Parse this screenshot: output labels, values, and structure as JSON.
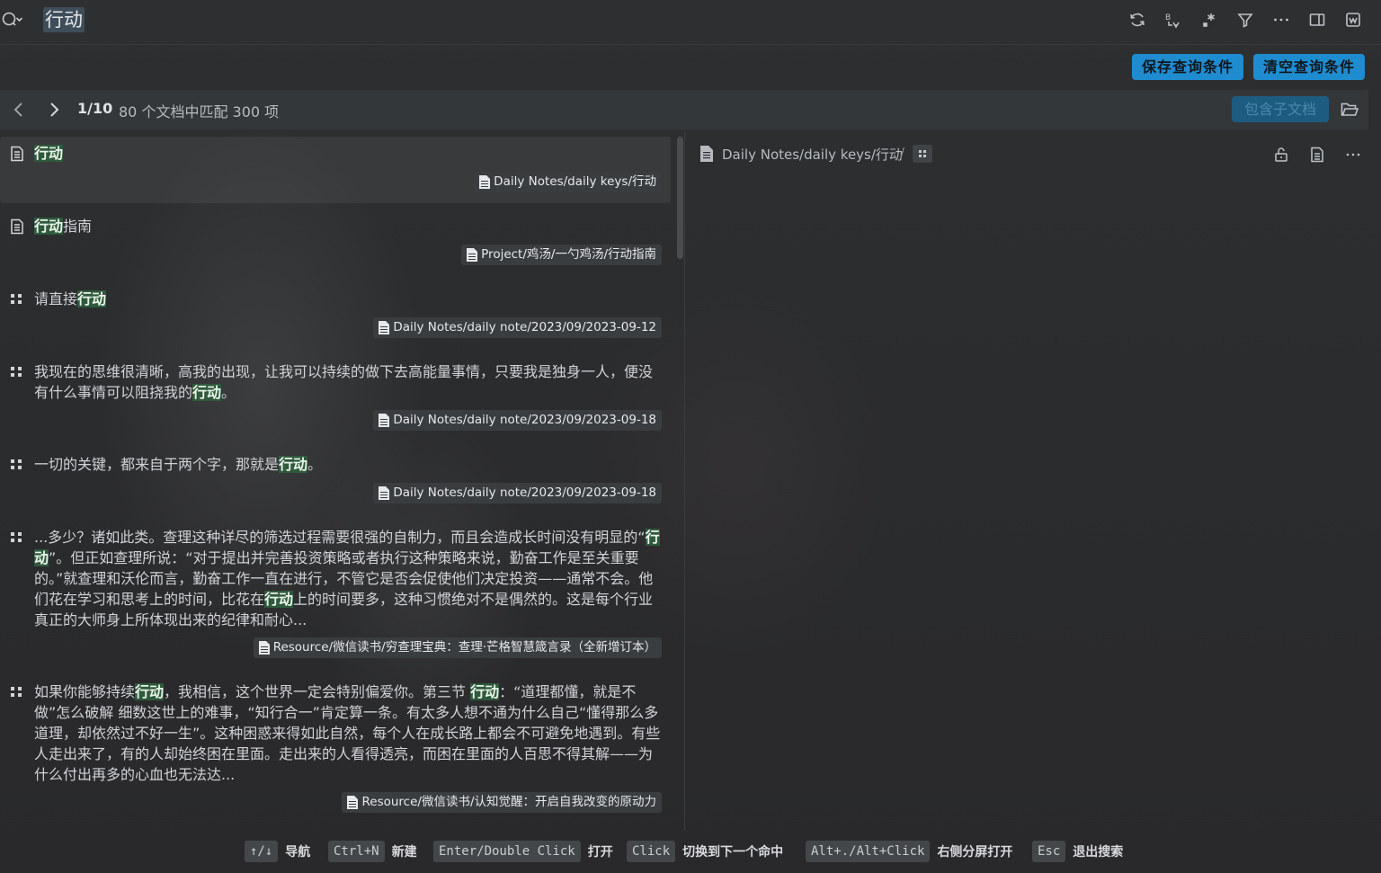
{
  "search": {
    "query": "行动"
  },
  "actions": {
    "save_query": "保存查询条件",
    "clear_query": "清空查询条件"
  },
  "nav": {
    "position": "1/10",
    "match_summary": "80 个文档中匹配 300 项",
    "include_children": "包含子文档"
  },
  "results": [
    {
      "type": "doc",
      "segments": [
        {
          "t": "行动",
          "hl": true
        }
      ],
      "path": "Daily Notes/daily keys/行动",
      "active": true
    },
    {
      "type": "doc",
      "segments": [
        {
          "t": "行动",
          "hl": true
        },
        {
          "t": "指南",
          "hl": false
        }
      ],
      "path": "Project/鸡汤/一勺鸡汤/行动指南"
    },
    {
      "type": "block",
      "segments": [
        {
          "t": "请直接",
          "hl": false
        },
        {
          "t": "行动",
          "hl": true
        }
      ],
      "path": "Daily Notes/daily note/2023/09/2023-09-12"
    },
    {
      "type": "block",
      "segments": [
        {
          "t": "我现在的思维很清晰，高我的出现，让我可以持续的做下去高能量事情，只要我是独身一人，便没有什么事情可以阻挠我的",
          "hl": false
        },
        {
          "t": "行动",
          "hl": true
        },
        {
          "t": "。",
          "hl": false
        }
      ],
      "path": "Daily Notes/daily note/2023/09/2023-09-18"
    },
    {
      "type": "block",
      "segments": [
        {
          "t": "一切的关键，都来自于两个字，那就是",
          "hl": false
        },
        {
          "t": "行动",
          "hl": true
        },
        {
          "t": "。",
          "hl": false
        }
      ],
      "path": "Daily Notes/daily note/2023/09/2023-09-18"
    },
    {
      "type": "block",
      "segments": [
        {
          "t": "...多少？诸如此类。查理这种详尽的筛选过程需要很强的自制力，而且会造成长时间没有明显的“",
          "hl": false
        },
        {
          "t": "行动",
          "hl": true
        },
        {
          "t": "”。但正如查理所说：“对于提出并完善投资策略或者执行这种策略来说，勤奋工作是至关重要的。”就查理和沃伦而言，勤奋工作一直在进行，不管它是否会促使他们决定投资——通常不会。他们花在学习和思考上的时间，比花在",
          "hl": false
        },
        {
          "t": "行动",
          "hl": true
        },
        {
          "t": "上的时间要多，这种习惯绝对不是偶然的。这是每个行业真正的大师身上所体现出来的纪律和耐心...",
          "hl": false
        }
      ],
      "path": "Resource/微信读书/穷查理宝典：查理·芒格智慧箴言录（全新增订本）"
    },
    {
      "type": "block",
      "segments": [
        {
          "t": "如果你能够持续",
          "hl": false
        },
        {
          "t": "行动",
          "hl": true
        },
        {
          "t": "，我相信，这个世界一定会特别偏爱你。第三节 ",
          "hl": false
        },
        {
          "t": "行动",
          "hl": true
        },
        {
          "t": "：“道理都懂，就是不做”怎么破解 细数这世上的难事，“知行合一”肯定算一条。有太多人想不通为什么自己“懂得那么多道理，却依然过不好一生”。这种困惑来得如此自然，每个人在成长路上都会不可避免地遇到。有些人走出来了，有的人却始终困在里面。走出来的人看得透亮，而困在里面的人百思不得其解——为什么付出再多的心血也无法达...",
          "hl": false
        }
      ],
      "path": "Resource/微信读书/认知觉醒：开启自我改变的原动力"
    }
  ],
  "preview": {
    "path": "Daily Notes/daily keys/行动",
    "separator": "/"
  },
  "footer": [
    {
      "key": "↑/↓",
      "label": "导航"
    },
    {
      "key": "Ctrl+N",
      "label": "新建"
    },
    {
      "key": "Enter/Double Click",
      "label": "打开"
    },
    {
      "key": "Click",
      "label": "切换到下一个命中"
    },
    {
      "key": "Alt+./Alt+Click",
      "label": "右侧分屏打开"
    },
    {
      "key": "Esc",
      "label": "退出搜索"
    }
  ]
}
